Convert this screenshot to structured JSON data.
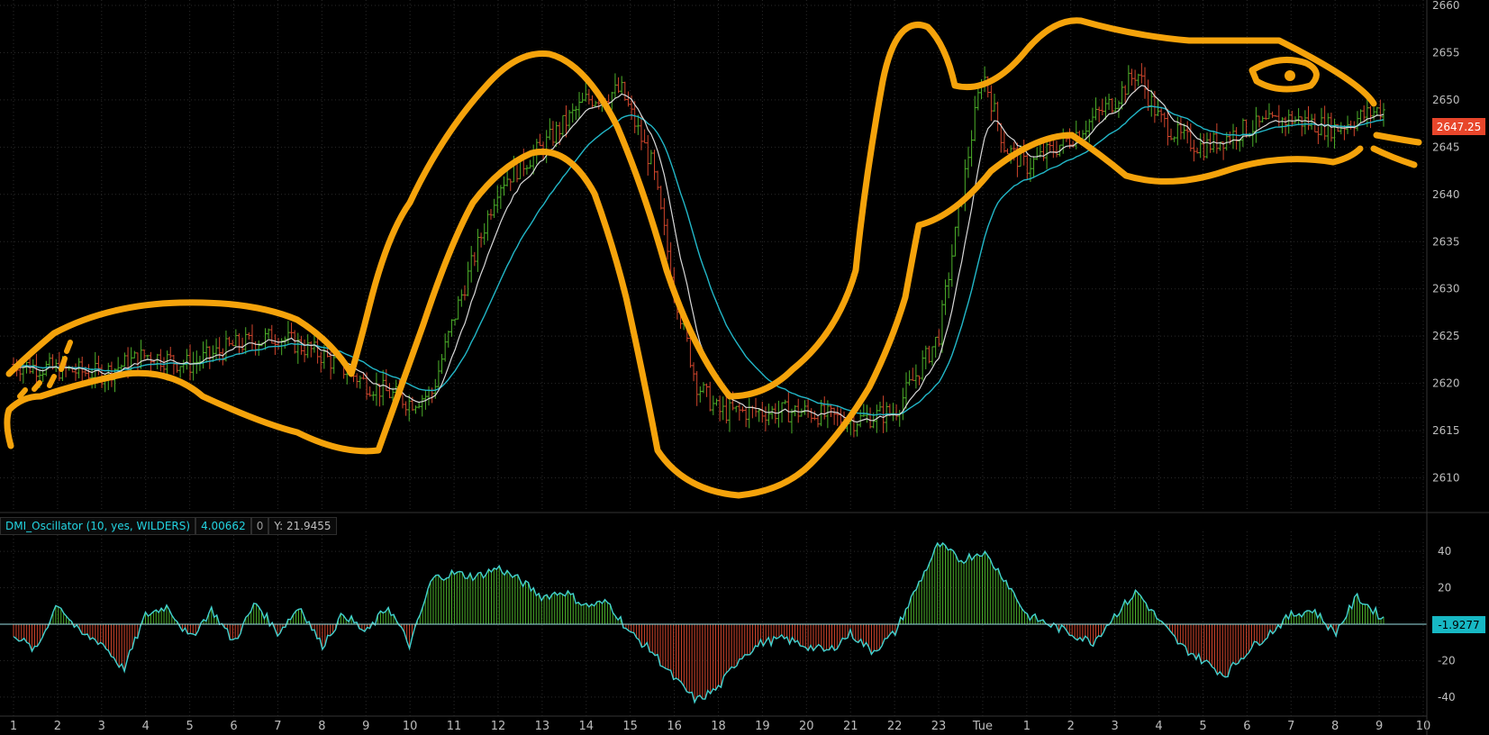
{
  "study": {
    "name": "DMI_Oscillator (10, yes, WILDERS)",
    "value": "4.00662",
    "zero": "0",
    "y_readout": "Y: 21.9455"
  },
  "tags": {
    "last_price": "2647.25",
    "osc_last": "-1.9277"
  },
  "colors": {
    "background": "#000000",
    "grid": "#2a2a2a",
    "up_bar": "#4caf2a",
    "down_bar": "#d0452c",
    "fast_ma": "#d8d8d8",
    "slow_ma": "#22b7c8",
    "osc_line": "#41d1cf",
    "osc_pos": "#4caf2a",
    "osc_neg": "#d0452c",
    "annotation": "#f5a30b"
  },
  "chart_data": [
    {
      "type": "line",
      "title": "",
      "xlabel": "",
      "ylabel": "",
      "ylim": [
        2607,
        2660
      ],
      "yticks": [
        2610,
        2615,
        2620,
        2625,
        2630,
        2635,
        2640,
        2645,
        2650,
        2655,
        2660
      ],
      "x_tick_labels": [
        "1",
        "2",
        "3",
        "4",
        "5",
        "6",
        "7",
        "8",
        "9",
        "10",
        "11",
        "12",
        "13",
        "14",
        "15",
        "16",
        "18",
        "19",
        "20",
        "21",
        "22",
        "23",
        "Tue",
        "1",
        "2",
        "3",
        "4",
        "5",
        "6",
        "7",
        "8",
        "9",
        "10"
      ],
      "grid": true,
      "series": [
        {
          "points": [
            [
              0,
              2622
            ],
            [
              2,
              2621
            ],
            [
              3,
              2623
            ],
            [
              4,
              2622
            ],
            [
              5,
              2624
            ],
            [
              6,
              2625
            ],
            [
              7,
              2623
            ],
            [
              8,
              2620
            ],
            [
              9,
              2618
            ],
            [
              9.5,
              2619
            ],
            [
              10,
              2627
            ],
            [
              11,
              2641
            ],
            [
              12,
              2645
            ],
            [
              13,
              2650
            ],
            [
              13.8,
              2651
            ],
            [
              14.5,
              2643
            ],
            [
              15,
              2630
            ],
            [
              15.5,
              2620
            ],
            [
              16,
              2617
            ],
            [
              18,
              2617
            ],
            [
              19,
              2616
            ],
            [
              20,
              2617
            ],
            [
              21,
              2625
            ],
            [
              21.7,
              2645
            ],
            [
              22,
              2653
            ],
            [
              22.5,
              2645
            ],
            [
              23,
              2643
            ],
            [
              24,
              2646
            ],
            [
              25,
              2650
            ],
            [
              25.5,
              2653
            ],
            [
              26,
              2648
            ],
            [
              26.5,
              2646
            ],
            [
              27,
              2645
            ],
            [
              28,
              2647
            ],
            [
              29,
              2648
            ],
            [
              30,
              2647
            ],
            [
              31,
              2649
            ],
            [
              32,
              2648
            ]
          ]
        }
      ],
      "last_price": 2647.25
    },
    {
      "type": "bar",
      "title": "DMI_Oscillator (10, yes, WILDERS)",
      "ylim": [
        -48,
        46
      ],
      "yticks": [
        40,
        20,
        -20,
        -40
      ],
      "series": [
        {
          "points": [
            [
              0,
              -5
            ],
            [
              0.5,
              -15
            ],
            [
              1,
              12
            ],
            [
              1.5,
              -5
            ],
            [
              2,
              -10
            ],
            [
              2.5,
              -25
            ],
            [
              3,
              5
            ],
            [
              3.5,
              10
            ],
            [
              4,
              -8
            ],
            [
              4.5,
              8
            ],
            [
              5,
              -10
            ],
            [
              5.5,
              12
            ],
            [
              6,
              -5
            ],
            [
              6.5,
              10
            ],
            [
              7,
              -12
            ],
            [
              7.5,
              6
            ],
            [
              8,
              -5
            ],
            [
              8.5,
              10
            ],
            [
              9,
              -12
            ],
            [
              9.5,
              25
            ],
            [
              10,
              28
            ],
            [
              10.5,
              26
            ],
            [
              11,
              31
            ],
            [
              11.5,
              24
            ],
            [
              12,
              15
            ],
            [
              12.5,
              18
            ],
            [
              13,
              10
            ],
            [
              13.5,
              12
            ],
            [
              14,
              -5
            ],
            [
              14.5,
              -15
            ],
            [
              15,
              -30
            ],
            [
              15.5,
              -42
            ],
            [
              16,
              -35
            ],
            [
              16.5,
              -18
            ],
            [
              17,
              -10
            ],
            [
              17.5,
              -8
            ],
            [
              18,
              -12
            ],
            [
              18.5,
              -15
            ],
            [
              19,
              -5
            ],
            [
              19.5,
              -15
            ],
            [
              20,
              -5
            ],
            [
              20.5,
              20
            ],
            [
              21,
              44
            ],
            [
              21.5,
              35
            ],
            [
              22,
              40
            ],
            [
              22.5,
              25
            ],
            [
              23,
              5
            ],
            [
              23.5,
              0
            ],
            [
              24,
              -5
            ],
            [
              24.5,
              -10
            ],
            [
              25,
              5
            ],
            [
              25.5,
              18
            ],
            [
              26,
              2
            ],
            [
              26.5,
              -12
            ],
            [
              27,
              -20
            ],
            [
              27.5,
              -28
            ],
            [
              28,
              -15
            ],
            [
              28.5,
              -5
            ],
            [
              29,
              5
            ],
            [
              29.5,
              8
            ],
            [
              30,
              -5
            ],
            [
              30.5,
              15
            ],
            [
              31,
              5
            ],
            [
              31.5,
              -5
            ],
            [
              32,
              -2
            ]
          ]
        }
      ],
      "last_value": -1.9277
    }
  ]
}
